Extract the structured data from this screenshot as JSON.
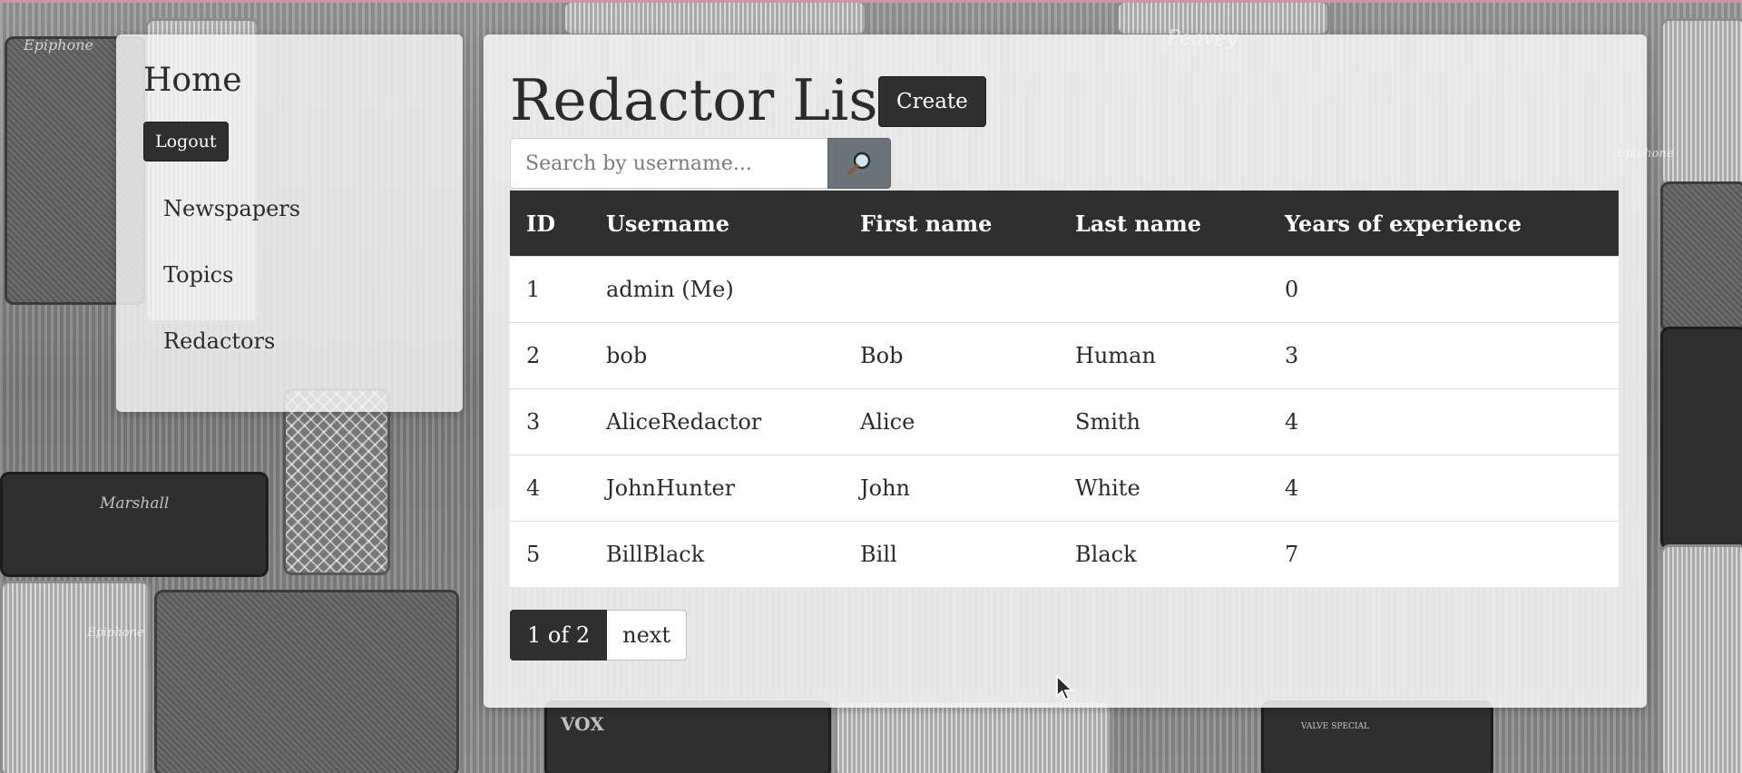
{
  "background": {
    "brand_labels": [
      "Epiphone",
      "Marshall",
      "Epiphone",
      "VOX",
      "Peavey",
      "Epiphone",
      "VALVE SPECIAL"
    ]
  },
  "sidebar": {
    "title": "Home",
    "logout_label": "Logout",
    "nav_items": [
      {
        "label": "Newspapers"
      },
      {
        "label": "Topics"
      },
      {
        "label": "Redactors"
      }
    ]
  },
  "main": {
    "title": "Redactor List",
    "create_label": "Create",
    "search": {
      "placeholder": "Search by username...",
      "value": "",
      "button_icon": "search-icon"
    },
    "table": {
      "columns": [
        "ID",
        "Username",
        "First name",
        "Last name",
        "Years of experience"
      ],
      "rows": [
        {
          "id": "1",
          "username": "admin (Me)",
          "first_name": "",
          "last_name": "",
          "years": "0"
        },
        {
          "id": "2",
          "username": "bob",
          "first_name": "Bob",
          "last_name": "Human",
          "years": "3"
        },
        {
          "id": "3",
          "username": "AliceRedactor",
          "first_name": "Alice",
          "last_name": "Smith",
          "years": "4"
        },
        {
          "id": "4",
          "username": "JohnHunter",
          "first_name": "John",
          "last_name": "White",
          "years": "4"
        },
        {
          "id": "5",
          "username": "BillBlack",
          "first_name": "Bill",
          "last_name": "Black",
          "years": "7"
        }
      ]
    },
    "pagination": {
      "current": "1 of 2",
      "next_label": "next"
    }
  },
  "colors": {
    "dark": "#2f2f2f",
    "panel": "#f7f7f7",
    "search_button": "#6b747c"
  }
}
